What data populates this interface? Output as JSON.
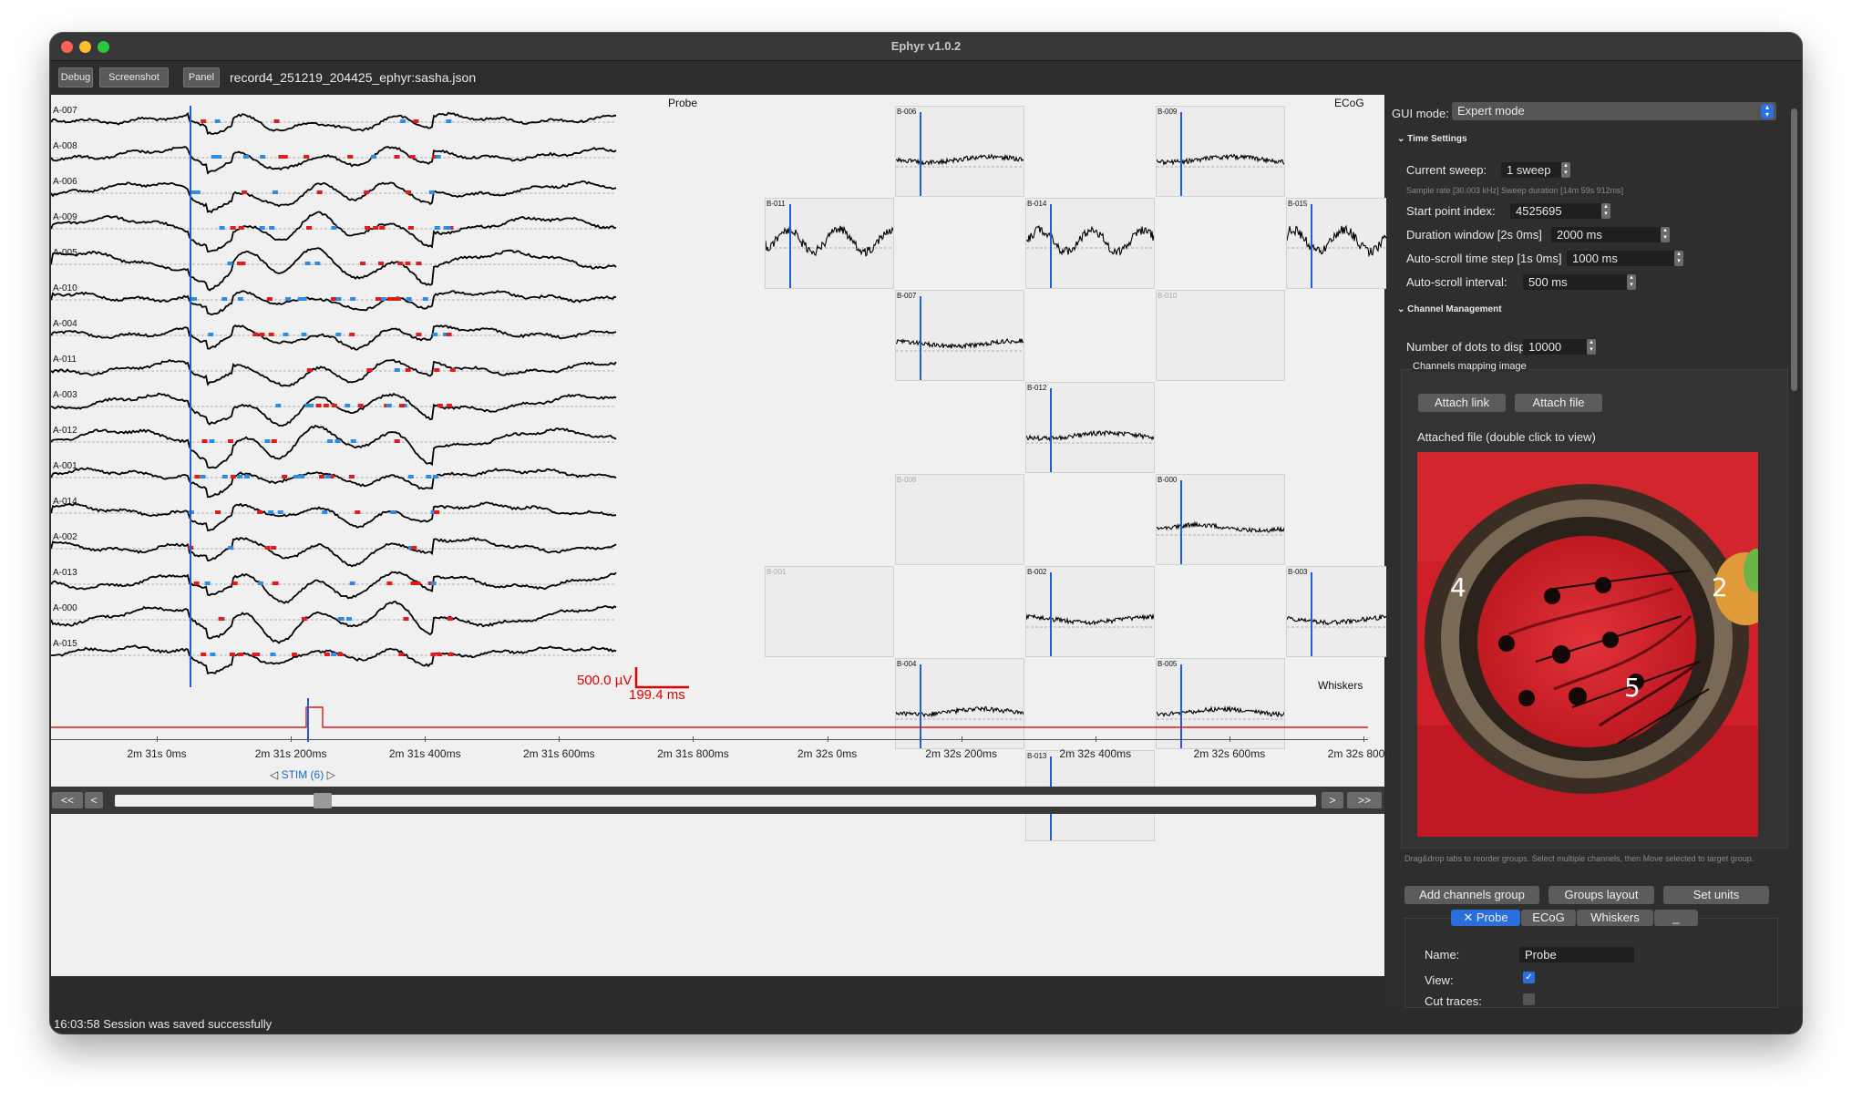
{
  "window": {
    "title": "Ephyr v1.0.2"
  },
  "toolbar": {
    "debug_label": "Debug",
    "screenshot_label": "Screenshot",
    "panel_label": "Panel",
    "file_name": "record4_251219_204425_ephyr:sasha.json"
  },
  "probe": {
    "title": "Probe",
    "channels": [
      "A-007",
      "A-008",
      "A-006",
      "A-009",
      "A-005",
      "A-010",
      "A-004",
      "A-011",
      "A-003",
      "A-012",
      "A-001",
      "A-014",
      "A-002",
      "A-013",
      "A-000",
      "A-015"
    ]
  },
  "ecog": {
    "title": "ECoG",
    "cells": [
      {
        "label": "B-006",
        "active": true
      },
      {
        "label": "B-009",
        "active": true
      },
      {
        "label": "B-011",
        "active": true
      },
      {
        "label": "B-014",
        "active": true
      },
      {
        "label": "B-015",
        "active": true
      },
      {
        "label": "B-007",
        "active": true
      },
      {
        "label": "B-010",
        "active": false
      },
      {
        "label": "B-012",
        "active": true
      },
      {
        "label": "B-008",
        "active": false
      },
      {
        "label": "B-000",
        "active": true
      },
      {
        "label": "B-001",
        "active": false
      },
      {
        "label": "B-002",
        "active": true
      },
      {
        "label": "B-003",
        "active": true
      },
      {
        "label": "B-004",
        "active": true
      },
      {
        "label": "B-005",
        "active": true
      },
      {
        "label": "B-013",
        "active": true
      }
    ]
  },
  "scale_bar": {
    "voltage": "500.0 µV",
    "time": "199.4 ms"
  },
  "whiskers": {
    "title": "Whiskers"
  },
  "time_axis": {
    "ticks": [
      "2m 31s 0ms",
      "2m 31s 200ms",
      "2m 31s 400ms",
      "2m 31s 600ms",
      "2m 31s 800ms",
      "2m 32s 0ms",
      "2m 32s 200ms",
      "2m 32s 400ms",
      "2m 32s 600ms",
      "2m 32s 800ms"
    ]
  },
  "stim": {
    "label": "STIM (6)",
    "prev_icon": "triangle-left-icon",
    "next_icon": "triangle-right-icon"
  },
  "nav": {
    "first": "<<",
    "prev": "<",
    "next": ">",
    "last": ">>"
  },
  "status": {
    "message": "16:03:58 Session was saved successfully"
  },
  "panel": {
    "gui_mode_label": "GUI mode:",
    "gui_mode_value": "Expert mode",
    "time_settings": {
      "title": "Time Settings",
      "current_sweep_label": "Current sweep:",
      "current_sweep_value": "1 sweep",
      "sample_info": "Sample rate [30.003 kHz]   Sweep duration [14m 59s 912ms]",
      "start_point_label": "Start point index:",
      "start_point_value": "4525695",
      "duration_label": "Duration window [2s 0ms]",
      "duration_value": "2000 ms",
      "autoscroll_step_label": "Auto-scroll time step [1s 0ms]",
      "autoscroll_step_value": "1000 ms",
      "autoscroll_interval_label": "Auto-scroll interval:",
      "autoscroll_interval_value": "500 ms"
    },
    "channel_management": {
      "title": "Channel Management",
      "dots_label": "Number of dots to display:",
      "dots_value": "10000",
      "mapping_title": "Channels mapping image",
      "attach_link": "Attach link",
      "attach_file": "Attach file",
      "attached_label": "Attached file (double click to view)",
      "photo_numbers": [
        "4",
        "2",
        "5"
      ]
    },
    "hint": "Drag&drop tabs to reorder groups. Select multiple channels, then Move selected to target group.",
    "buttons": {
      "add_group": "Add channels group",
      "groups_layout": "Groups layout",
      "set_units": "Set units"
    },
    "tabs": [
      {
        "label": "Probe",
        "closable": true,
        "active": true
      },
      {
        "label": "ECoG",
        "active": false
      },
      {
        "label": "Whiskers",
        "active": false
      },
      {
        "label": "_",
        "active": false
      }
    ],
    "props": {
      "name_label": "Name:",
      "name_value": "Probe",
      "view_label": "View:",
      "view_checked": true,
      "cut_label": "Cut traces:",
      "cut_checked": false
    }
  }
}
